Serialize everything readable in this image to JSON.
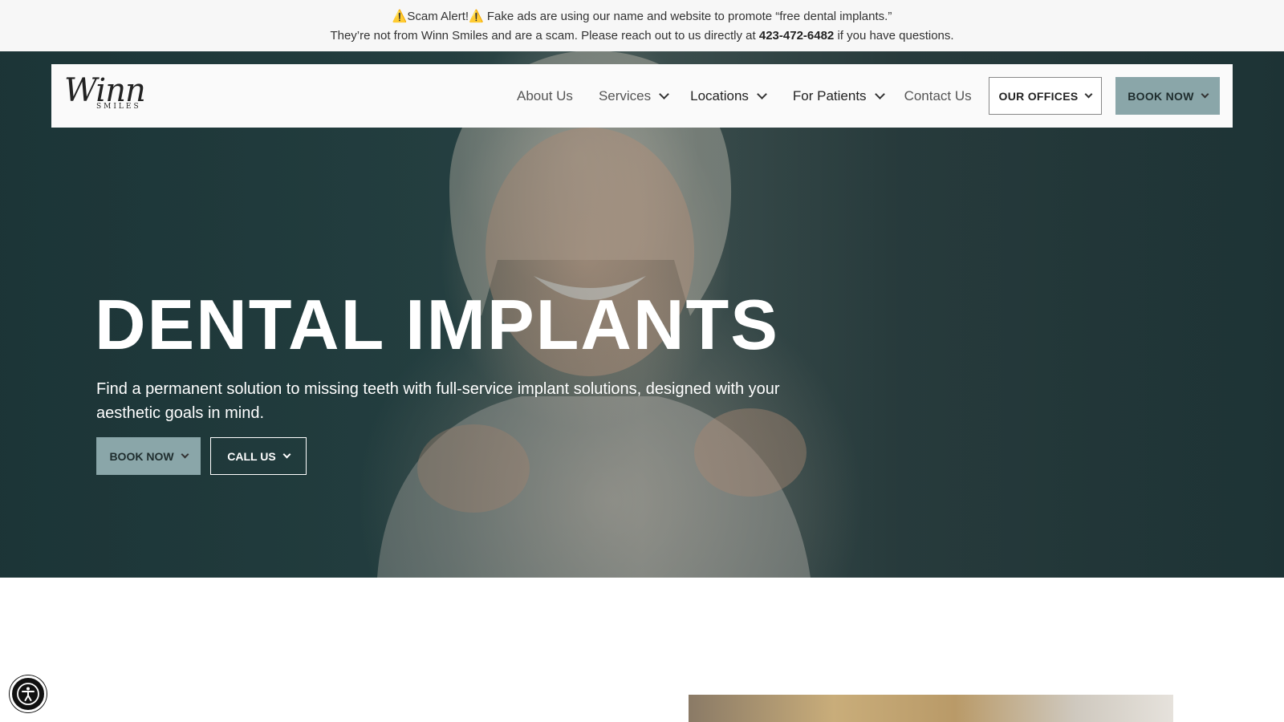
{
  "alert": {
    "line1": "⚠️Scam Alert!⚠️ Fake ads are using our name and website to promote “free dental implants.”",
    "line2_before": "They’re not from Winn Smiles and are a scam. Please reach out to us directly at ",
    "phone": "423-472-6482",
    "line2_after": " if you have questions."
  },
  "logo": {
    "script": "Winn",
    "sub": "SMILES"
  },
  "nav": {
    "items": [
      {
        "label": "About Us"
      },
      {
        "label": "Services"
      },
      {
        "label": "Locations"
      },
      {
        "label": "For Patients"
      },
      {
        "label": "Contact Us"
      }
    ],
    "offices_label": "OUR OFFICES",
    "book_label": "BOOK NOW"
  },
  "hero": {
    "title": "DENTAL IMPLANTS",
    "subtitle": "Find a permanent solution to missing teeth with full-service implant solutions, designed with your aesthetic goals in mind.",
    "book_label": "BOOK NOW",
    "call_label": "CALL US"
  },
  "colors": {
    "accent_teal": "#8aa6a9",
    "hero_dark": "#254446"
  },
  "icons": [
    "chevron-down-icon",
    "accessibility-icon"
  ]
}
